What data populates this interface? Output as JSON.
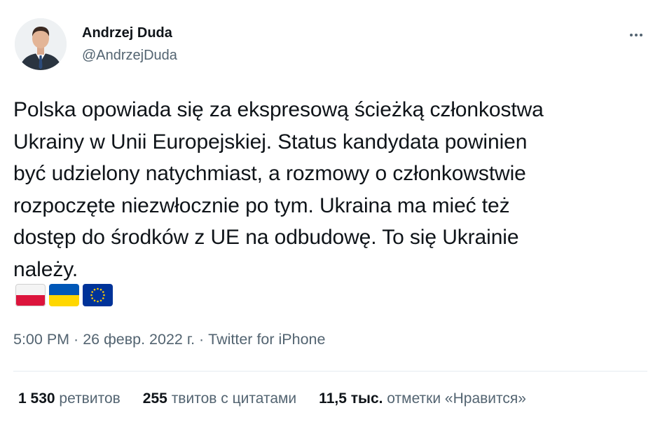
{
  "author": {
    "name": "Andrzej Duda",
    "handle": "@AndrzejDuda"
  },
  "tweet": {
    "line1": "Polska opowiada się za ekspresową ścieżką członkostwa",
    "line2": "Ukrainy w Unii Europejskiej. Status kandydata powinien",
    "line3": "być udzielony natychmiast, a rozmowy o członkowstwie",
    "line4": "rozpoczęte niezwłocznie po tym. Ukraina ma mieć też",
    "line5": "dostęp do środków z UE na odbudowę. To się Ukrainie",
    "line6": "należy.",
    "emojis": [
      "flag-poland-icon",
      "flag-ukraine-icon",
      "flag-eu-icon"
    ]
  },
  "meta": {
    "time": "5:00 PM",
    "separator": " · ",
    "date": "26 февр. 2022 г.",
    "source": "Twitter for iPhone"
  },
  "stats": {
    "retweets_count": "1 530",
    "retweets_label": "ретвитов",
    "quotes_count": "255",
    "quotes_label": "твитов с цитатами",
    "likes_count": "11,5 тыс.",
    "likes_label": "отметки «Нравится»"
  },
  "colors": {
    "text": "#0f1419",
    "secondary": "#536471",
    "divider": "#e6ecf0",
    "poland_red": "#dc143c",
    "ukraine_blue": "#0057b7",
    "ukraine_yellow": "#ffd700",
    "eu_blue": "#003399",
    "eu_star": "#ffcc00"
  }
}
